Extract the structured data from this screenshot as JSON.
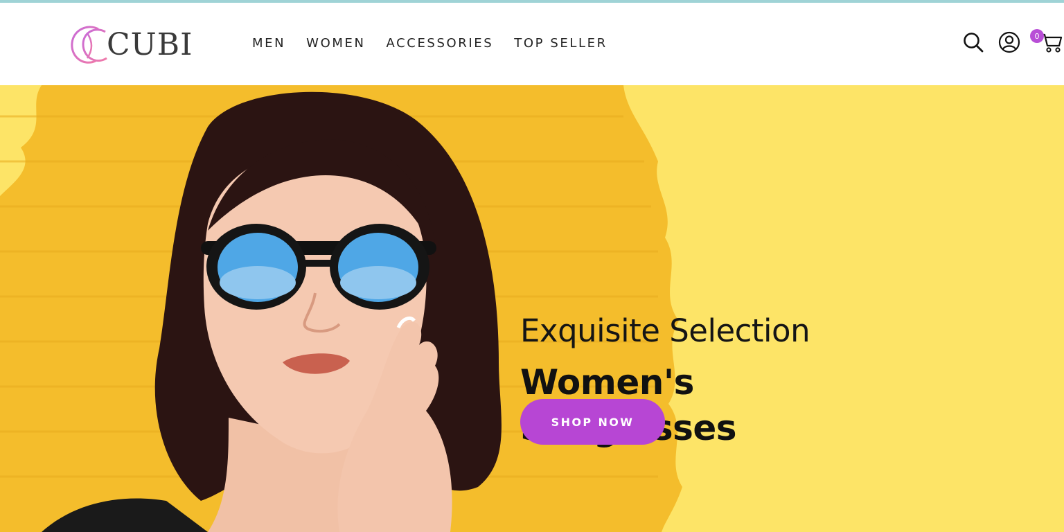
{
  "brand": {
    "name": "CUBI",
    "accent": "#b746d4"
  },
  "nav": {
    "items": [
      {
        "label": "MEN"
      },
      {
        "label": "WOMEN"
      },
      {
        "label": "ACCESSORIES"
      },
      {
        "label": "TOP SELLER"
      }
    ]
  },
  "header_icons": {
    "search": "search-icon",
    "account": "user-icon",
    "cart": "cart-icon",
    "cart_count": "0"
  },
  "hero": {
    "subtitle": "Exquisite Selection",
    "title": "Women's Sunglasses",
    "cta_label": "SHOP NOW",
    "background_color": "#fde467"
  }
}
